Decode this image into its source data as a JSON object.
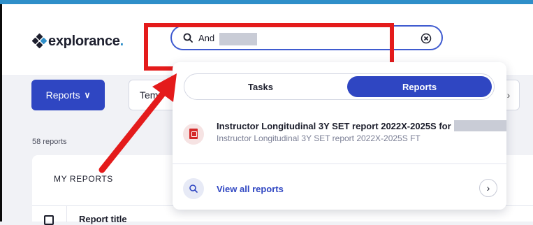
{
  "header": {
    "logo_text": "explorance",
    "logo_dot": "."
  },
  "search": {
    "value": "And",
    "icon": "search-icon",
    "clear_icon": "close-circle-icon"
  },
  "toolbar": {
    "reports_label": "Reports",
    "reports_chevron": "∨",
    "templates_label": "Temp",
    "right_button": "›"
  },
  "report_count": "58 reports",
  "my_reports": {
    "title": "MY REPORTS",
    "column_title": "Report title"
  },
  "dropdown": {
    "tabs": [
      "Tasks",
      "Reports"
    ],
    "active_tab": "Reports",
    "result": {
      "title": "Instructor Longitudinal 3Y SET report 2022X-2025S for",
      "subtitle": "Instructor Longitudinal 3Y SET report 2022X-2025S FT",
      "icon": "pdf-icon"
    },
    "view_all_label": "View all reports",
    "view_all_chevron": "›"
  },
  "colors": {
    "accent": "#2f46c2",
    "highlight": "#e41b1b",
    "topbar": "#2f8fc9"
  }
}
